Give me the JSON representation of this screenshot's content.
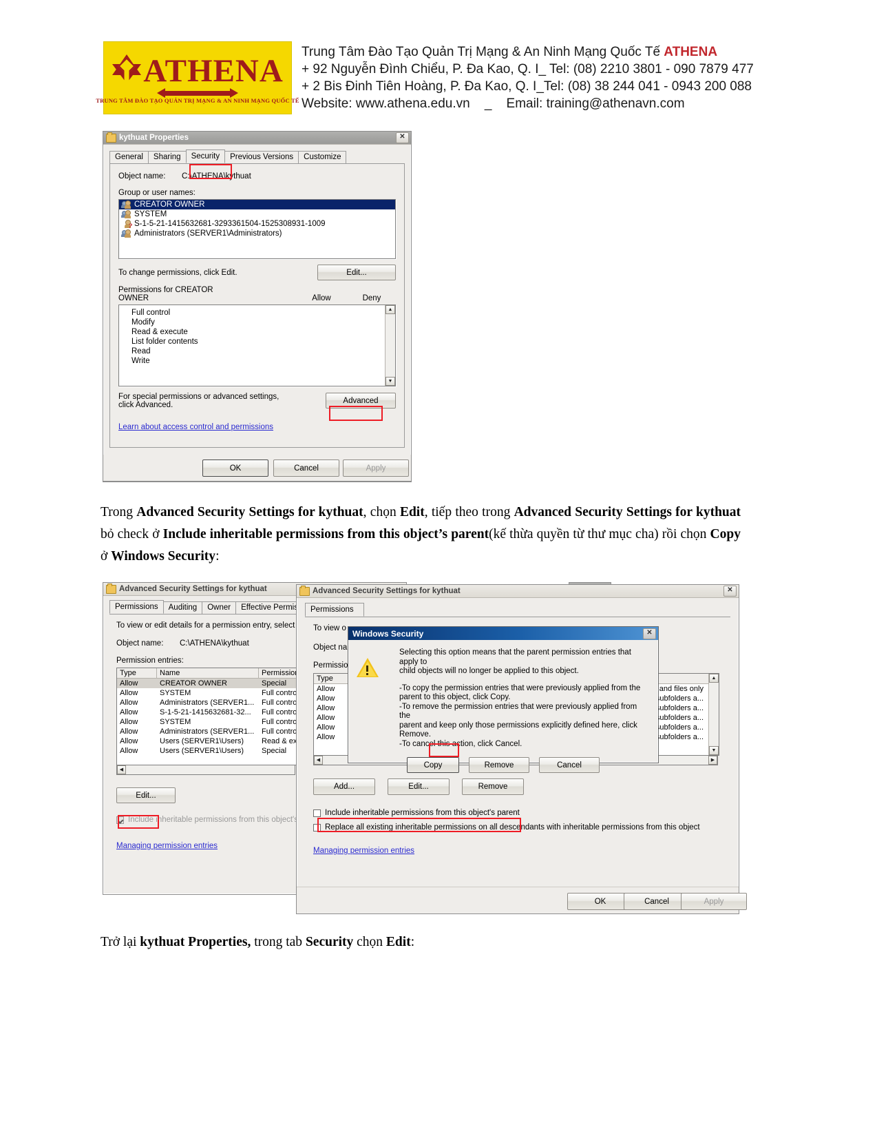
{
  "letterhead": {
    "logo_word": "ATHENA",
    "logo_sub": "TRUNG TÂM ĐÀO TẠO QUẢN TRỊ MẠNG & AN NINH MẠNG QUỐC TẾ",
    "line1_a": "Trung Tâm Đào Tạo Quản Trị Mạng & An Ninh Mạng Quốc Tế ",
    "line1_b": "ATHENA",
    "line2": "+ 92 Nguyễn Đình Chiểu, P. Đa Kao, Q. I_ Tel: (08) 2210 3801 -  090 7879 477",
    "line3": "+ 2 Bis Đinh Tiên Hoàng, P. Đa Kao, Q. I_Tel: (08) 38 244 041 - 0943 200 088",
    "line4_a": "Website: www.athena.edu.vn",
    "line4_sep": "_",
    "line4_b": "Email: training@athenavn.com",
    "accent_red": "#c1272d",
    "logo_bg": "#f5d800"
  },
  "props_dialog": {
    "title": "kythuat Properties",
    "close_label": "✕",
    "tabs": [
      {
        "label": "General",
        "selected": false
      },
      {
        "label": "Sharing",
        "selected": false
      },
      {
        "label": "Security",
        "selected": true
      },
      {
        "label": "Previous Versions",
        "selected": false
      },
      {
        "label": "Customize",
        "selected": false
      }
    ],
    "object_name_label": "Object name:",
    "object_name_value": "C:\\ATHENA\\kythuat",
    "group_label": "Group or user names:",
    "users": [
      {
        "name": "CREATOR OWNER",
        "selected": true,
        "icon": "users-icon"
      },
      {
        "name": "SYSTEM",
        "selected": false,
        "icon": "users-icon"
      },
      {
        "name": "S-1-5-21-1415632681-3293361504-1525308931-1009",
        "selected": false,
        "icon": "unknown-user-icon"
      },
      {
        "name": "Administrators (SERVER1\\Administrators)",
        "selected": false,
        "icon": "users-icon"
      }
    ],
    "change_hint": "To change permissions, click Edit.",
    "edit_button": "Edit...",
    "perm_title_line1": "Permissions for CREATOR",
    "perm_title_line2": "OWNER",
    "allow_col": "Allow",
    "deny_col": "Deny",
    "permissions": [
      "Full control",
      "Modify",
      "Read & execute",
      "List folder contents",
      "Read",
      "Write"
    ],
    "advanced_hint_line1": "For special permissions or advanced settings,",
    "advanced_hint_line2": "click Advanced.",
    "advanced_button": "Advanced",
    "learn_link": "Learn about access control and permissions",
    "ok_button": "OK",
    "cancel_button": "Cancel",
    "apply_button": "Apply",
    "highlight_color": "#ee1c25"
  },
  "body_text": {
    "p1_seg1": "Trong ",
    "p1_b1": "Advanced Security Settings for kythuat",
    "p1_seg2": ", chọn ",
    "p1_b2": "Edit",
    "p1_seg3": ", tiếp theo trong ",
    "p1_b3": "Advanced Security Settings for kythuat",
    "p1_seg4": " bỏ check ở ",
    "p1_b4": "Include inheritable permissions from this object’s parent",
    "p1_seg5": "(kế thừa quyền từ thư mục cha) rồi chọn ",
    "p1_b5": "Copy",
    "p1_seg6": " ở ",
    "p1_b6": "Windows Security",
    "p1_seg7": ":",
    "p2_seg1": "Trở lại ",
    "p2_b1": "kythuat Properties,",
    "p2_seg2": " trong tab ",
    "p2_b2": "Security",
    "p2_seg3": " chọn ",
    "p2_b3": "Edit",
    "p2_seg4": ":"
  },
  "adv_back": {
    "title": "Advanced Security Settings for kythuat",
    "tabs": [
      {
        "label": "Permissions",
        "selected": true
      },
      {
        "label": "Auditing",
        "selected": false
      },
      {
        "label": "Owner",
        "selected": false
      },
      {
        "label": "Effective Permissions",
        "selected": false
      }
    ],
    "hint": "To view or edit details for a permission entry, select the",
    "object_name_label": "Object name:",
    "object_name_value": "C:\\ATHENA\\kythuat",
    "entries_label": "Permission entries:",
    "columns": [
      "Type",
      "Name",
      "Permission"
    ],
    "rows": [
      {
        "type": "Allow",
        "name": "CREATOR OWNER",
        "permission": "Special",
        "selected": true
      },
      {
        "type": "Allow",
        "name": "SYSTEM",
        "permission": "Full contro",
        "selected": false
      },
      {
        "type": "Allow",
        "name": "Administrators (SERVER1...",
        "permission": "Full contro",
        "selected": false
      },
      {
        "type": "Allow",
        "name": "S-1-5-21-1415632681-32...",
        "permission": "Full contro",
        "selected": false
      },
      {
        "type": "Allow",
        "name": "SYSTEM",
        "permission": "Full contro",
        "selected": false
      },
      {
        "type": "Allow",
        "name": "Administrators (SERVER1...",
        "permission": "Full contro",
        "selected": false
      },
      {
        "type": "Allow",
        "name": "Users (SERVER1\\Users)",
        "permission": "Read & ex",
        "selected": false
      },
      {
        "type": "Allow",
        "name": "Users (SERVER1\\Users)",
        "permission": "Special",
        "selected": false
      }
    ],
    "edit_button": "Edit...",
    "include_checkbox_label": "Include inheritable permissions from this object's pa",
    "include_checked": true,
    "managing_link": "Managing permission entries"
  },
  "adv_front": {
    "title": "Advanced Security Settings for kythuat",
    "close_label": "✕",
    "tabs": [
      {
        "label": "Permissions",
        "selected": true
      }
    ],
    "hint_partial": "To view o",
    "object_name_partial": "Object na",
    "entries_partial": "Permission",
    "col_type": "Type",
    "rows": [
      {
        "type": "Allow",
        "applies": "and files only"
      },
      {
        "type": "Allow",
        "applies": "subfolders a..."
      },
      {
        "type": "Allow",
        "applies": "subfolders a..."
      },
      {
        "type": "Allow",
        "applies": "subfolders a..."
      },
      {
        "type": "Allow",
        "applies": "subfolders a..."
      },
      {
        "type": "Allow",
        "applies": "subfolders a..."
      }
    ],
    "add_button": "Add...",
    "edit_button": "Edit...",
    "remove_button": "Remove",
    "include_checkbox_label": "Include inheritable permissions from this object's parent",
    "include_checked": false,
    "replace_checkbox_label": "Replace all existing inheritable permissions on all descendants with inheritable permissions from this object",
    "replace_checked": false,
    "managing_link": "Managing permission entries",
    "ok_button": "OK",
    "cancel_button": "Cancel",
    "apply_button": "Apply"
  },
  "win_security": {
    "title": "Windows Security",
    "close_label": "✕",
    "icon": "warning-icon",
    "p1_line1": "Selecting this option means that the parent permission entries that apply to",
    "p1_line2": "child objects will no longer be applied to this object.",
    "p2_line1": "-To copy  the permission entries that were previously applied from the",
    "p2_line2": "parent to this object, click Copy.",
    "p3_line1": "-To remove the permission entries that were previously applied from the",
    "p3_line2": "parent and keep only those permissions explicitly defined here, click",
    "p3_line3": "Remove.",
    "p4": "-To cancel this action, click Cancel.",
    "copy_button": "Copy",
    "remove_button": "Remove",
    "cancel_button": "Cancel"
  }
}
